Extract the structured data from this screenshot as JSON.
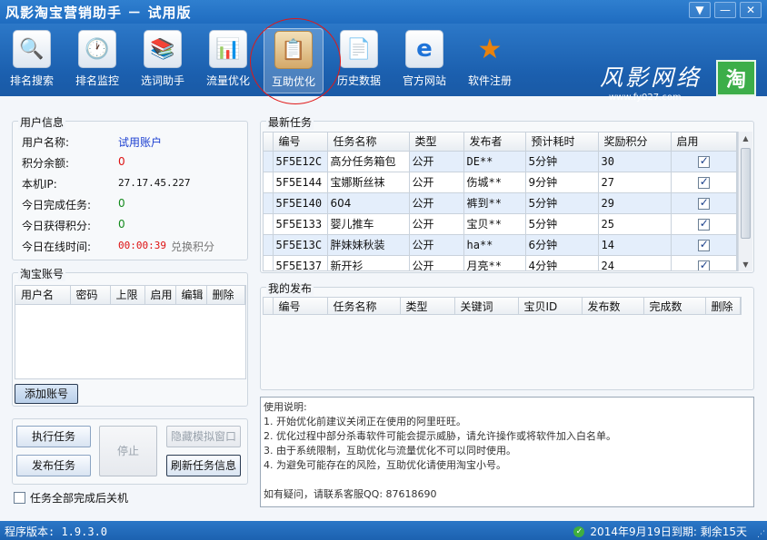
{
  "app": {
    "title": "风影淘宝营销助手 － 试用版",
    "window_buttons": {
      "dropdown": "▼",
      "minimize": "—",
      "close": "✕"
    }
  },
  "toolbar": {
    "items": [
      {
        "label": "排名搜索",
        "icon": "magnifier-icon",
        "glyph": "🔍"
      },
      {
        "label": "排名监控",
        "icon": "clock-icon",
        "glyph": "🕐"
      },
      {
        "label": "选词助手",
        "icon": "books-icon",
        "glyph": "📚"
      },
      {
        "label": "流量优化",
        "icon": "bar-chart-icon",
        "glyph": "📊"
      },
      {
        "label": "互助优化",
        "icon": "clipboard-icon",
        "glyph": "📋"
      },
      {
        "label": "历史数据",
        "icon": "word-document-icon",
        "glyph": "📄"
      },
      {
        "label": "官方网站",
        "icon": "ie-icon",
        "glyph": "e"
      },
      {
        "label": "软件注册",
        "icon": "medal-icon",
        "glyph": "★"
      }
    ],
    "active_index": 4,
    "brand_title": "风影网络",
    "brand_url": "www.fy027.com",
    "tao_logo": "淘"
  },
  "user_info": {
    "title": "用户信息",
    "rows": [
      {
        "label": "用户名称:",
        "value": "试用账户"
      },
      {
        "label": "积分余额:",
        "value": "0"
      },
      {
        "label": "本机IP:",
        "value": "27.17.45.227"
      },
      {
        "label": "今日完成任务:",
        "value": "0"
      },
      {
        "label": "今日获得积分:",
        "value": "0"
      },
      {
        "label": "今日在线时间:",
        "value": "00:00:39"
      }
    ],
    "exchange_link": "兑换积分"
  },
  "taobao_accounts": {
    "title": "淘宝账号",
    "columns": [
      "用户名",
      "密码",
      "上限",
      "启用",
      "编辑",
      "删除"
    ],
    "add_button": "添加账号"
  },
  "actions": {
    "execute": "执行任务",
    "stop": "停止",
    "hide_window": "隐藏模拟窗口",
    "publish": "发布任务",
    "refresh": "刷新任务信息",
    "shutdown_checkbox": "任务全部完成后关机"
  },
  "latest_tasks": {
    "title": "最新任务",
    "columns": [
      "编号",
      "任务名称",
      "类型",
      "发布者",
      "预计耗时",
      "奖励积分",
      "启用"
    ],
    "rows": [
      {
        "id": "5F5E12C",
        "name": "高分任务箱包",
        "type": "公开",
        "publisher": "DE**",
        "time": "5分钟",
        "points": "30",
        "enabled": true
      },
      {
        "id": "5F5E144",
        "name": "宝娜斯丝袜",
        "type": "公开",
        "publisher": "伤城**",
        "time": "9分钟",
        "points": "27",
        "enabled": true
      },
      {
        "id": "5F5E140",
        "name": "604",
        "type": "公开",
        "publisher": "裤到**",
        "time": "5分钟",
        "points": "29",
        "enabled": true
      },
      {
        "id": "5F5E133",
        "name": "婴儿推车",
        "type": "公开",
        "publisher": "宝贝**",
        "time": "5分钟",
        "points": "25",
        "enabled": true
      },
      {
        "id": "5F5E13C",
        "name": "胖妹妹秋装",
        "type": "公开",
        "publisher": "ha**",
        "time": "6分钟",
        "points": "14",
        "enabled": true
      },
      {
        "id": "5F5E137",
        "name": "新开衫",
        "type": "公开",
        "publisher": "月亮**",
        "time": "4分钟",
        "points": "24",
        "enabled": true
      }
    ]
  },
  "my_published": {
    "title": "我的发布",
    "columns": [
      "编号",
      "任务名称",
      "类型",
      "关键词",
      "宝贝ID",
      "发布数",
      "完成数",
      "删除"
    ]
  },
  "notes": {
    "lines": [
      "使用说明:",
      "1. 开始优化前建议关闭正在使用的阿里旺旺。",
      "2. 优化过程中部分杀毒软件可能会提示威胁，请允许操作或将软件加入白名单。",
      "3. 由于系统限制，互助优化与流量优化不可以同时使用。",
      "4. 为避免可能存在的风险，互助优化请使用淘宝小号。",
      "",
      "如有疑问，请联系客服QQ: 87618690"
    ]
  },
  "status": {
    "version": "程序版本: 1.9.3.0",
    "expiry": "2014年9月19日到期: 剩余15天"
  },
  "colors": {
    "title_blue": "#1f6cc0",
    "highlight_red": "#e01818",
    "value_red": "#dd1111",
    "value_green": "#138a1c",
    "username_blue": "#1c3fd1"
  }
}
